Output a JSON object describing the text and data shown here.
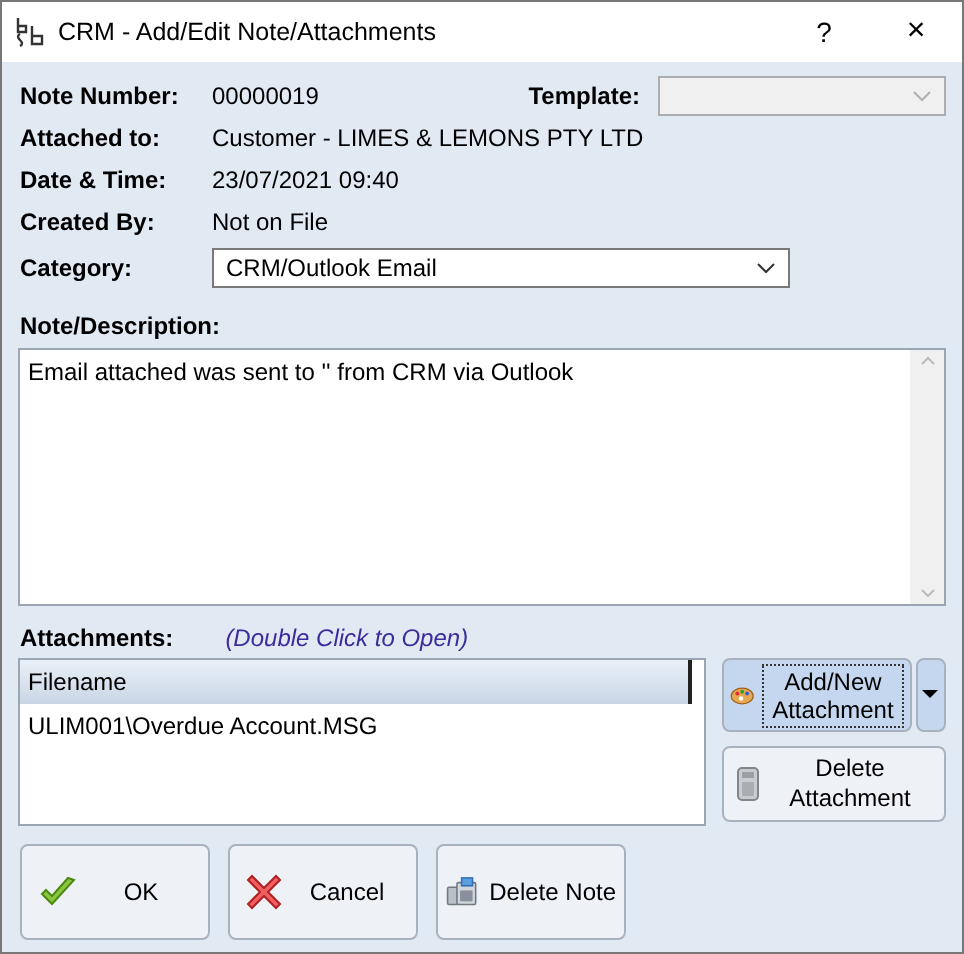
{
  "window": {
    "title": "CRM - Add/Edit Note/Attachments",
    "help": "?",
    "close": "×"
  },
  "note_number": {
    "label": "Note Number:",
    "value": "00000019"
  },
  "template": {
    "label": "Template:",
    "disabled": true
  },
  "fields": [
    {
      "label": "Attached to:",
      "value": "Customer - LIMES & LEMONS PTY LTD"
    },
    {
      "label": "Date & Time:",
      "value": "23/07/2021 09:40"
    },
    {
      "label": "Created By:",
      "value": "Not on File"
    }
  ],
  "category": {
    "label": "Category:",
    "value": "CRM/Outlook Email"
  },
  "description": {
    "label": "Note/Description:",
    "value": "Email attached was sent to '' from CRM via Outlook"
  },
  "attachments": {
    "label": "Attachments:",
    "hint": "(Double Click to Open)",
    "columns": [
      "Filename"
    ],
    "rows": [
      "ULIM001\\Overdue Account.MSG"
    ]
  },
  "attachment_buttons": [
    {
      "kind": "add",
      "label": "Add/New Attachment"
    },
    {
      "kind": "delete",
      "label": "Delete Attachment"
    }
  ],
  "buttons": [
    {
      "kind": "ok",
      "label": "OK"
    },
    {
      "kind": "cancel",
      "label": "Cancel"
    },
    {
      "kind": "delete",
      "label": "Delete Note"
    }
  ]
}
